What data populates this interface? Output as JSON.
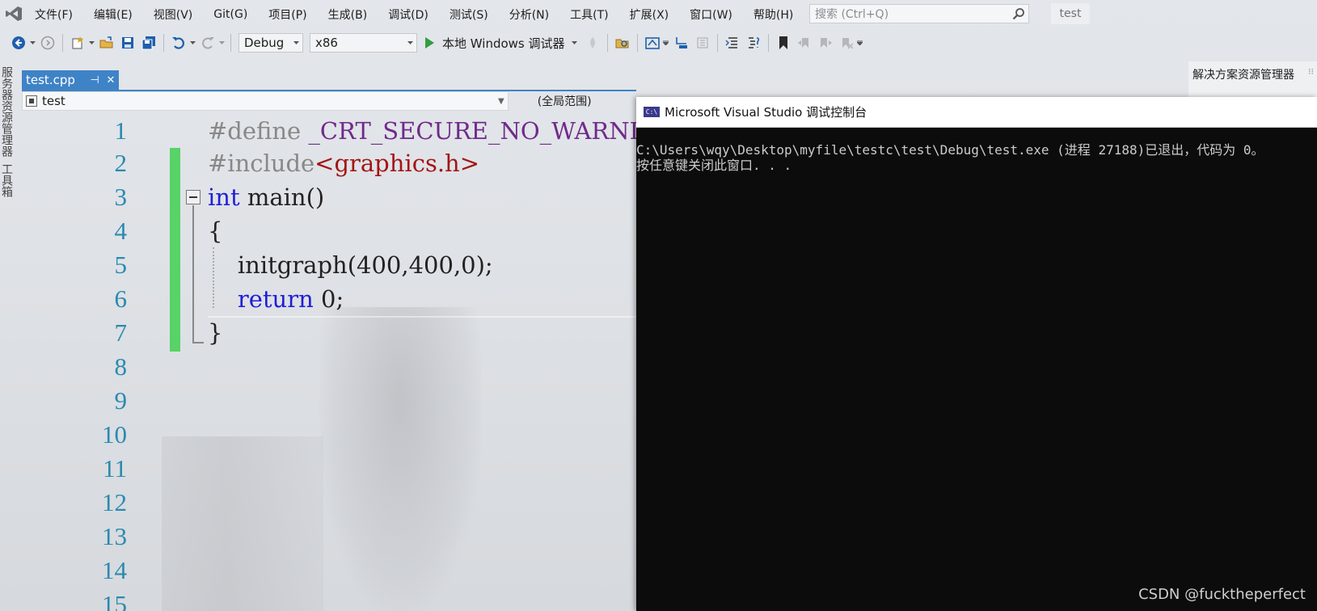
{
  "menubar": {
    "items": [
      "文件(F)",
      "编辑(E)",
      "视图(V)",
      "Git(G)",
      "项目(P)",
      "生成(B)",
      "调试(D)",
      "测试(S)",
      "分析(N)",
      "工具(T)",
      "扩展(X)",
      "窗口(W)",
      "帮助(H)"
    ],
    "search_placeholder": "搜索 (Ctrl+Q)",
    "solution_name": "test"
  },
  "toolbar": {
    "configuration": "Debug",
    "platform": "x86",
    "run_label": "本地 Windows 调试器"
  },
  "side_tabs": [
    "服务器资源管理器",
    "工具箱"
  ],
  "document_tab": {
    "filename": "test.cpp",
    "pin": "⊣",
    "close": "✕"
  },
  "navbar": {
    "scope": "test",
    "global_scope": "(全局范围)"
  },
  "solution_explorer": {
    "title": "解决方案资源管理器"
  },
  "editor": {
    "line_numbers": [
      "1",
      "2",
      "3",
      "4",
      "5",
      "6",
      "7",
      "8",
      "9",
      "10",
      "11",
      "12",
      "13",
      "14",
      "15"
    ],
    "code": {
      "l1_directive": "#define",
      "l1_macro": " _CRT_SECURE_NO_WARNINGS",
      "l2_directive": "#include",
      "l2_header": "<graphics.h>",
      "l3_keyword": "int",
      "l3_rest": " main()",
      "l4": "{",
      "l5": "    initgraph(400,400,0);",
      "l6_indent": "    ",
      "l6_keyword": "return",
      "l6_rest": " 0;",
      "l7": "}"
    }
  },
  "console": {
    "title": "Microsoft Visual Studio 调试控制台",
    "icon_text": "C:\\",
    "line1": "C:\\Users\\wqy\\Desktop\\myfile\\testc\\test\\Debug\\test.exe (进程 27188)已退出，代码为 0。",
    "line2": "按任意键关闭此窗口. . ."
  },
  "watermark": "CSDN @fucktheperfect",
  "colors": {
    "accent_tab": "#3f83c7",
    "change_bar": "#57d367",
    "keyword": "#1f1fd6",
    "line_number": "#2b8ab0",
    "console_bg": "#0c0c0c"
  }
}
